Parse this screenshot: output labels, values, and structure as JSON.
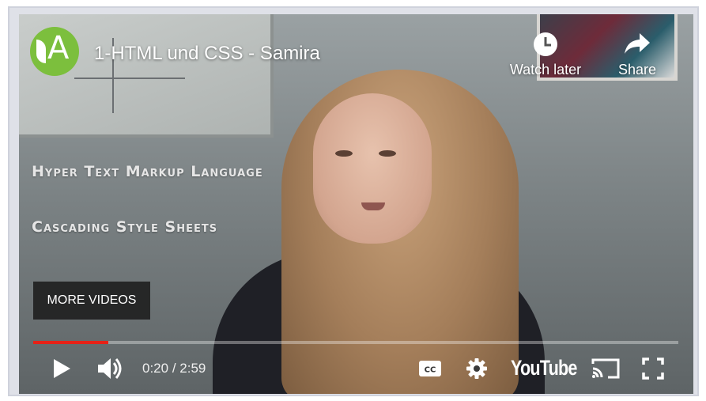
{
  "video": {
    "title": "1-HTML und CSS - Samira",
    "channel_avatar_letter": "A",
    "channel_avatar_color": "#7cbf3d"
  },
  "scene": {
    "line1": "Hyper Text Markup Language",
    "line2": "Cascading Style Sheets"
  },
  "actions": {
    "watch_later": "Watch later",
    "share": "Share"
  },
  "more_videos_label": "MORE VIDEOS",
  "playback": {
    "current": "0:20",
    "separator": " / ",
    "duration": "2:59",
    "played_fraction": 0.117,
    "buffered_fraction": 0.0,
    "accent_color": "#e62117"
  },
  "controls": {
    "logo_text": "YouTube",
    "icons": [
      "play-icon",
      "volume-icon",
      "captions-icon",
      "settings-icon",
      "cast-icon",
      "fullscreen-icon"
    ]
  }
}
